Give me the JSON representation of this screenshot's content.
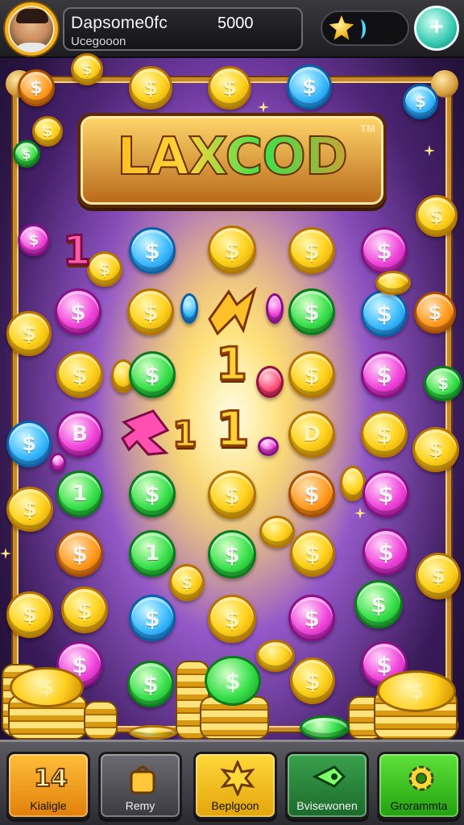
{
  "header": {
    "player_name": "Dapsome0fc",
    "player_subtitle": "Ucegooon",
    "score": "5000",
    "plus_symbol": "+"
  },
  "logo": {
    "title": "LAXCOD",
    "tm": "TM"
  },
  "board": {
    "coin_symbol": "$",
    "glyphs": [
      "1",
      "1",
      "1",
      "1"
    ],
    "special_coin_labels": [
      "B",
      "D",
      "1",
      "1"
    ]
  },
  "nav": {
    "items": [
      {
        "icon_text": "14",
        "label": "Kialigle",
        "icon": "number-badge-icon"
      },
      {
        "icon_text": "",
        "label": "Remy",
        "icon": "bag-icon"
      },
      {
        "icon_text": "",
        "label": "Beplgoon",
        "icon": "star-burst-icon"
      },
      {
        "icon_text": "",
        "label": "Bvisewonen",
        "icon": "ticket-icon"
      },
      {
        "icon_text": "",
        "label": "Grorammta",
        "icon": "gear-icon"
      }
    ]
  },
  "colors": {
    "gold": "#ffd21c",
    "frame": "#c88a2b",
    "accent_teal": "#33c9b0"
  }
}
